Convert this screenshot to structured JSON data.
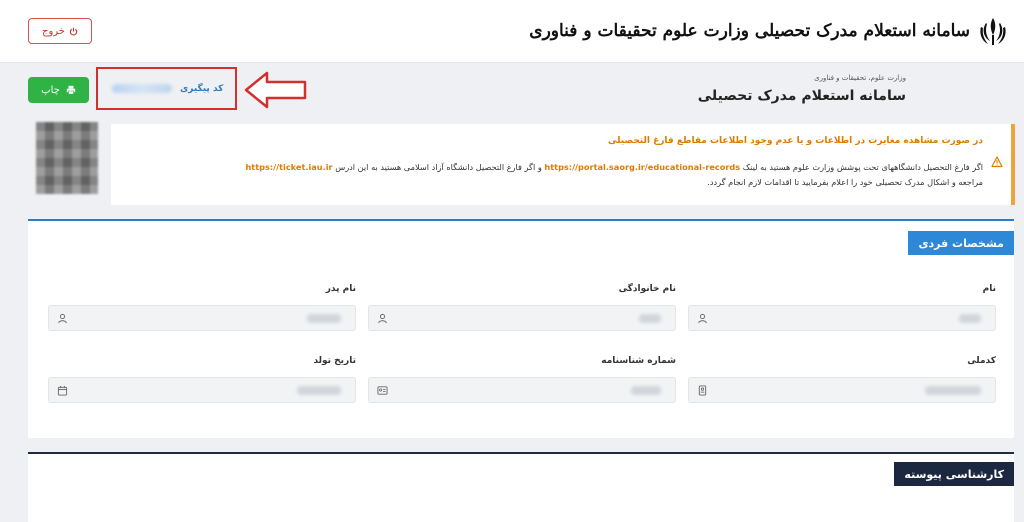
{
  "header": {
    "brand_title": "سامانه استعلام مدرک تحصیلی وزارت علوم تحقیقات و فناوری",
    "logout_label": "خروج"
  },
  "page": {
    "breadcrumb": "وزارت علوم، تحقیقات و فناوری",
    "title": "سامانه استعلام مدرک تحصیلی",
    "print_label": "چاپ",
    "tracking_label": "کد پیگیری"
  },
  "alert": {
    "title": "در صورت مشاهده مغایرت در اطلاعات و یا عدم وجود اطلاعات مقاطع فارغ التحصیلی",
    "line1_part1": "اگر فارغ التحصیل دانشگاههای تحت پوشش وزارت علوم هستید به لینک",
    "link1": "https://portal.saorg.ir/educational-records",
    "line1_part2": "و اگر فارغ التحصیل دانشگاه آزاد اسلامی هستید به این ادرس",
    "link2": "https://ticket.iau.ir",
    "line2": "مراجعه و اشکال مدرک تحصیلی خود را اعلام بفرمایید تا اقدامات لازم انجام گردد."
  },
  "personal": {
    "section_title": "مشخصات فردی",
    "fields": {
      "first_name": "نام",
      "last_name": "نام خانوادگی",
      "father_name": "نام پدر",
      "national_code": "کدملی",
      "id_number": "شماره شناسنامه",
      "birth_date": "تاریخ تولد"
    }
  },
  "section2": {
    "title": "کارشناسی پیوسته"
  },
  "colors": {
    "accent_blue": "#2d88d8",
    "print_green": "#2fb344",
    "warning_orange": "#e07b00",
    "highlight_red": "#d32f2f",
    "dark_navy": "#1c2740"
  }
}
